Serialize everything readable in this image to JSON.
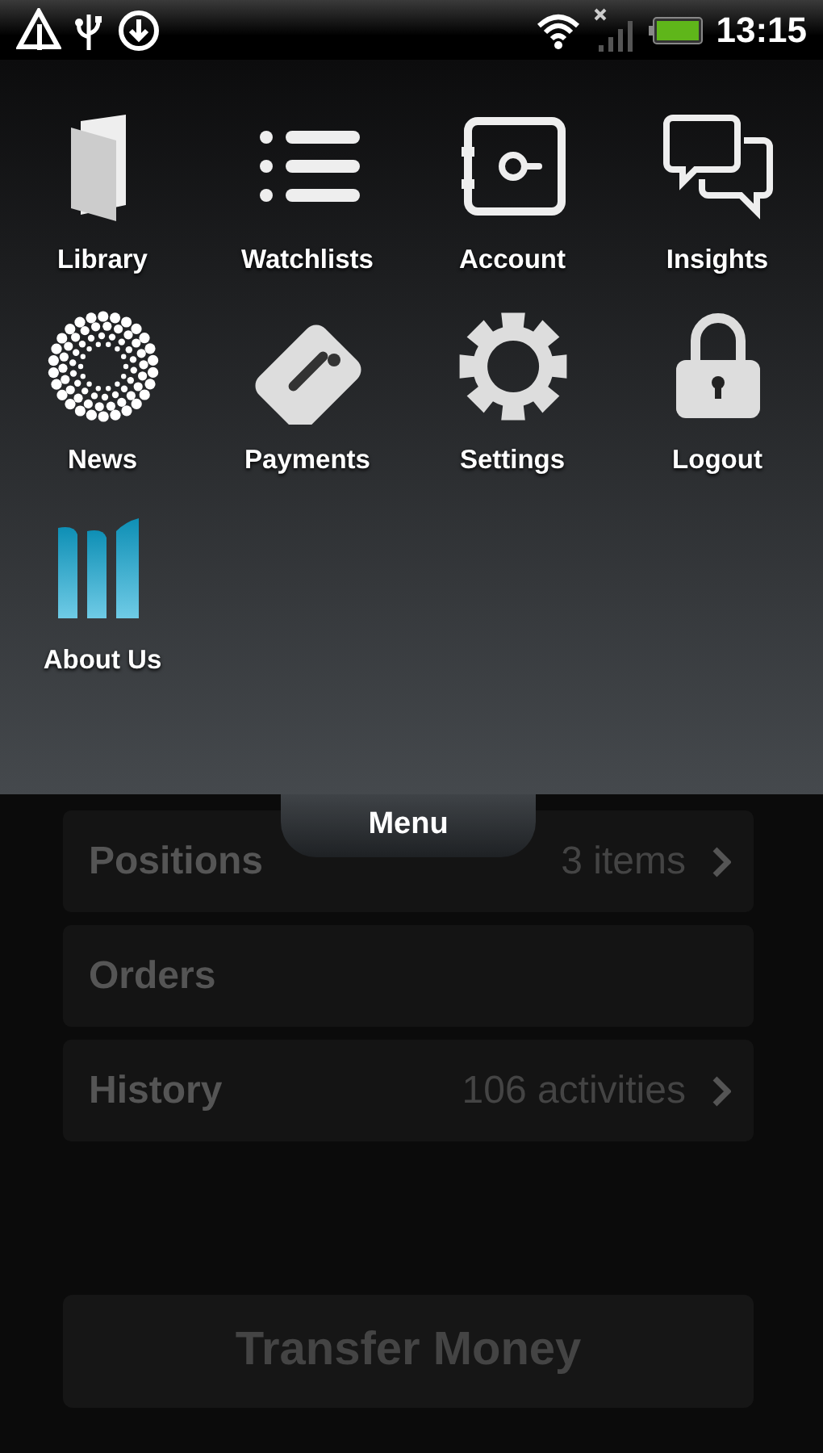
{
  "status_bar": {
    "time": "13:15"
  },
  "menu": {
    "items": [
      {
        "label": "Library",
        "kind": "library"
      },
      {
        "label": "Watchlists",
        "kind": "watchlists"
      },
      {
        "label": "Account",
        "kind": "account"
      },
      {
        "label": "Insights",
        "kind": "insights"
      },
      {
        "label": "News",
        "kind": "news"
      },
      {
        "label": "Payments",
        "kind": "payments"
      },
      {
        "label": "Settings",
        "kind": "settings"
      },
      {
        "label": "Logout",
        "kind": "logout"
      },
      {
        "label": "About Us",
        "kind": "about"
      }
    ],
    "tab_label": "Menu"
  },
  "rows": [
    {
      "label": "Positions",
      "detail": "3 items",
      "arrow": true
    },
    {
      "label": "Orders",
      "arrow": false
    },
    {
      "label": "History",
      "detail": "106 activities",
      "arrow": true
    }
  ],
  "transfer_button": "Transfer Money"
}
